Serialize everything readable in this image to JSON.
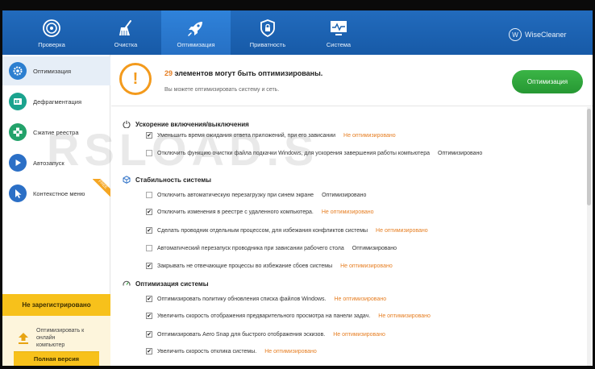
{
  "nav": {
    "items": [
      {
        "label": "Проверка",
        "icon": "target-icon"
      },
      {
        "label": "Очистка",
        "icon": "broom-icon"
      },
      {
        "label": "Оптимизация",
        "icon": "rocket-icon"
      },
      {
        "label": "Приватность",
        "icon": "lock-shield-icon"
      },
      {
        "label": "Система",
        "icon": "monitor-pulse-icon"
      }
    ],
    "active": "Оптимизация",
    "brand": "WiseCleaner",
    "brand_logo": "W"
  },
  "sidebar": {
    "items": [
      {
        "label": "Оптимизация",
        "icon": "gear-icon"
      },
      {
        "label": "Дефрагментация",
        "icon": "disk-icon"
      },
      {
        "label": "Сжатие реестра",
        "icon": "registry-cubes-icon"
      },
      {
        "label": "Автозапуск",
        "icon": "play-icon"
      },
      {
        "label": "Контекстное меню",
        "icon": "cursor-icon",
        "badge": "FREE"
      }
    ],
    "register_banner": "Не зарегистрировано",
    "upgrade_text": "Оптимизировать к онлайн",
    "upgrade_text_line2": "компьютер",
    "full_version_button": "Полная версия"
  },
  "summary": {
    "count": "29",
    "title": " элементов могут быть оптимизированы.",
    "subtitle": "Вы можете оптимизировать систему и сеть.",
    "button": "Оптимизация"
  },
  "sections": [
    {
      "title": "Ускорение включения/выключения",
      "icon": "power-icon",
      "rows": [
        {
          "checked": true,
          "text": "Уменьшить время ожидания ответа приложений, при его зависании",
          "status": "Не оптимизировано",
          "optimized": false
        },
        {
          "checked": false,
          "text": "Отключить функцию очистки файла подкачки Windows, для ускорения завершения работы компьютера",
          "status": "Оптимизировано",
          "optimized": true
        }
      ]
    },
    {
      "title": "Стабильность системы",
      "icon": "cube-icon",
      "rows": [
        {
          "checked": false,
          "text": "Отключить автоматическую перезагрузку при синем экране",
          "status": "Оптимизировано",
          "optimized": true
        },
        {
          "checked": true,
          "text": "Отключить изменения в реестре с удаленного компьютера.",
          "status": "Не оптимизировано",
          "optimized": false
        },
        {
          "checked": true,
          "text": "Сделать проводник отдельным процессом, для избежания конфликтов системы",
          "status": "Не оптимизировано",
          "optimized": false
        },
        {
          "checked": false,
          "text": "Автоматический перезапуск проводника при зависании рабочего стола",
          "status": "Оптимизировано",
          "optimized": true
        },
        {
          "checked": true,
          "text": "Закрывать не отвечающие процессы во избежание сбоев системы",
          "status": "Не оптимизировано",
          "optimized": false
        }
      ]
    },
    {
      "title": "Оптимизация системы",
      "icon": "speedometer-icon",
      "rows": [
        {
          "checked": true,
          "text": "Оптимизировать политику обновления списка файлов Windows.",
          "status": "Не оптимизировано",
          "optimized": false
        },
        {
          "checked": true,
          "text": "Увеличить скорость отображения предварительного просмотра на панели задач.",
          "status": "Не оптимизировано",
          "optimized": false
        },
        {
          "checked": true,
          "text": "Оптимизировать Aero Snap для быстрого отображения эскизов.",
          "status": "Не оптимизировано",
          "optimized": false
        },
        {
          "checked": true,
          "text": "Увеличить скорость отклика системы.",
          "status": "Не оптимизировано",
          "optimized": false
        }
      ]
    }
  ],
  "watermark": "RSLOAD.S",
  "colors": {
    "topbar": "#1b62b0",
    "accent_green": "#2ea43a",
    "warning_orange": "#e67e22",
    "register_yellow": "#f7c11b"
  }
}
